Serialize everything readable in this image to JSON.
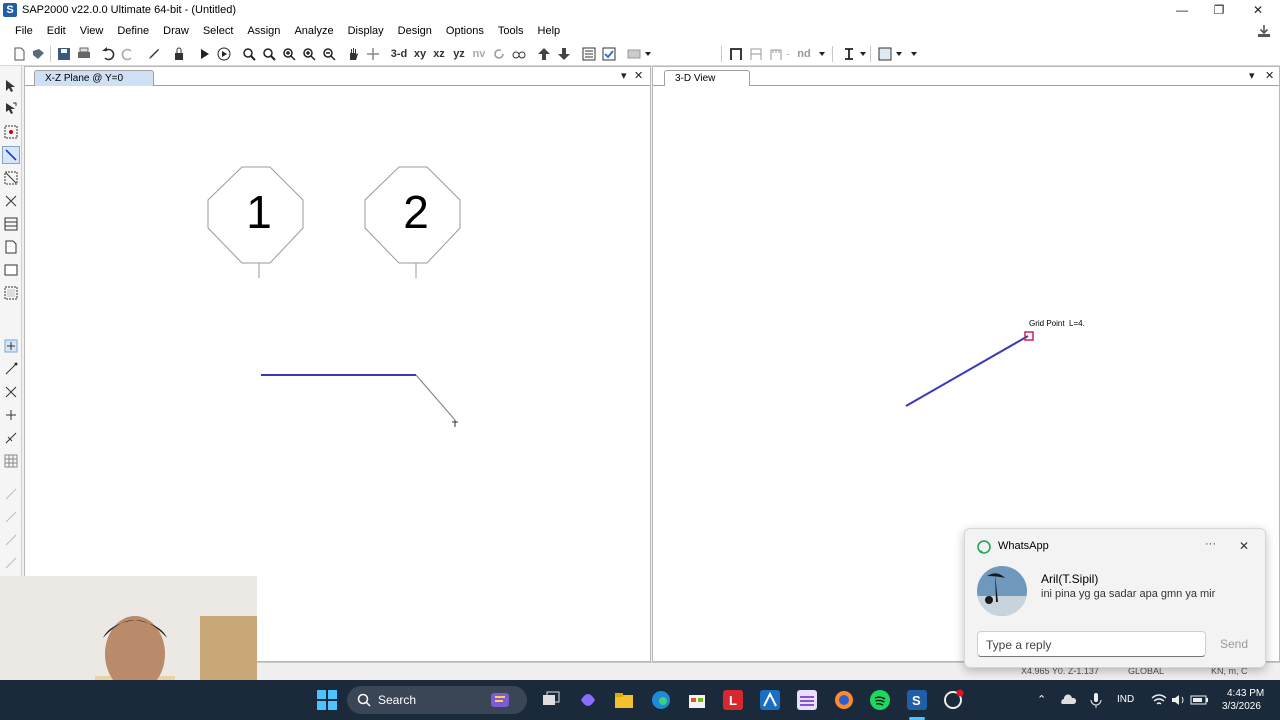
{
  "window": {
    "title": "SAP2000 v22.0.0 Ultimate 64-bit - (Untitled)",
    "logo_letter": "S",
    "controls": {
      "minimize": "—",
      "restore": "❐",
      "close": "✕"
    }
  },
  "menu": [
    "File",
    "Edit",
    "View",
    "Define",
    "Draw",
    "Select",
    "Assign",
    "Analyze",
    "Display",
    "Design",
    "Options",
    "Tools",
    "Help"
  ],
  "toolbar": {
    "view_3d": "3-d",
    "view_xy": "xy",
    "view_xz": "xz",
    "view_yz": "yz",
    "view_nv": "nv",
    "nd": "nd"
  },
  "left_panel": {
    "tab": "X-Z Plane @ Y=0",
    "grid_bubbles": [
      "1",
      "2"
    ]
  },
  "right_panel": {
    "tab": "3-D View",
    "grid_point_label": "Grid Point  L=4."
  },
  "statusbar": {
    "coords": "X4.965  Y0.  Z-1.137",
    "coord_system": "GLOBAL",
    "units": "KN, m, C"
  },
  "notification": {
    "app": "WhatsApp",
    "sender": "Aril(T.Sipil)",
    "message": "ini pina yg ga sadar apa gmn ya mir",
    "reply_placeholder": "Type a reply",
    "send": "Send",
    "more": "···",
    "close": "✕"
  },
  "taskbar": {
    "search": "Search",
    "language": "IND",
    "time": "4:43 PM",
    "date": "3/3/2026"
  },
  "colors": {
    "frame_line": "#3a3ab8",
    "grid_point": "#d0205a"
  }
}
